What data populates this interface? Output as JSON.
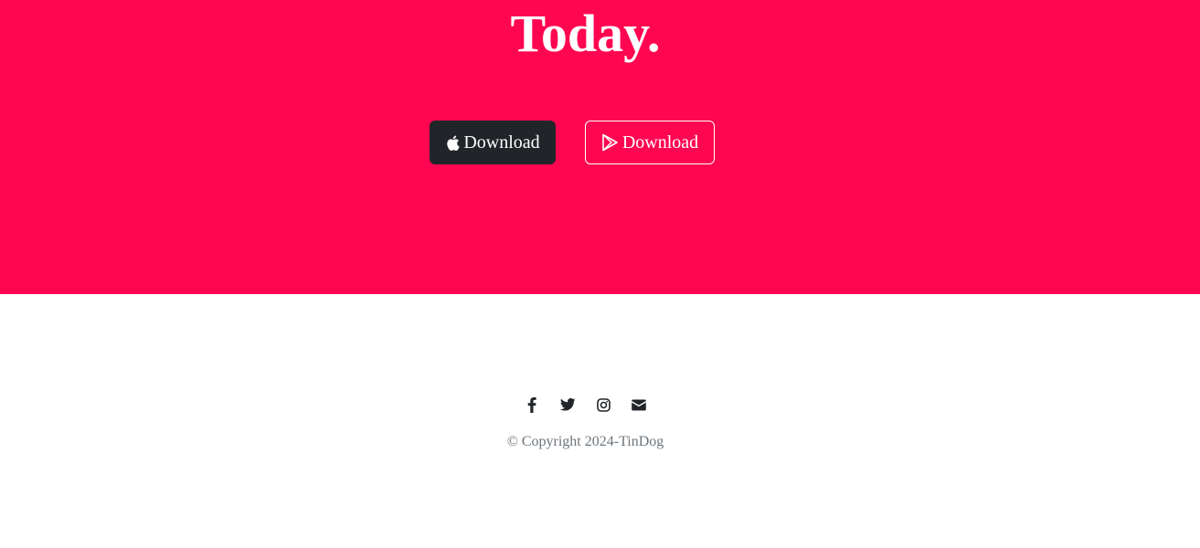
{
  "cta": {
    "title": "Today.",
    "background_color": "#ff0650"
  },
  "buttons": {
    "apple": {
      "label": "Download",
      "icon": "apple-icon",
      "color": "#212529"
    },
    "google_play": {
      "label": "Download",
      "icon": "google-play-icon"
    }
  },
  "footer": {
    "social_icons": [
      "facebook-icon",
      "twitter-icon",
      "instagram-icon",
      "envelope-icon"
    ],
    "copyright": "© Copyright 2024-TinDog"
  }
}
